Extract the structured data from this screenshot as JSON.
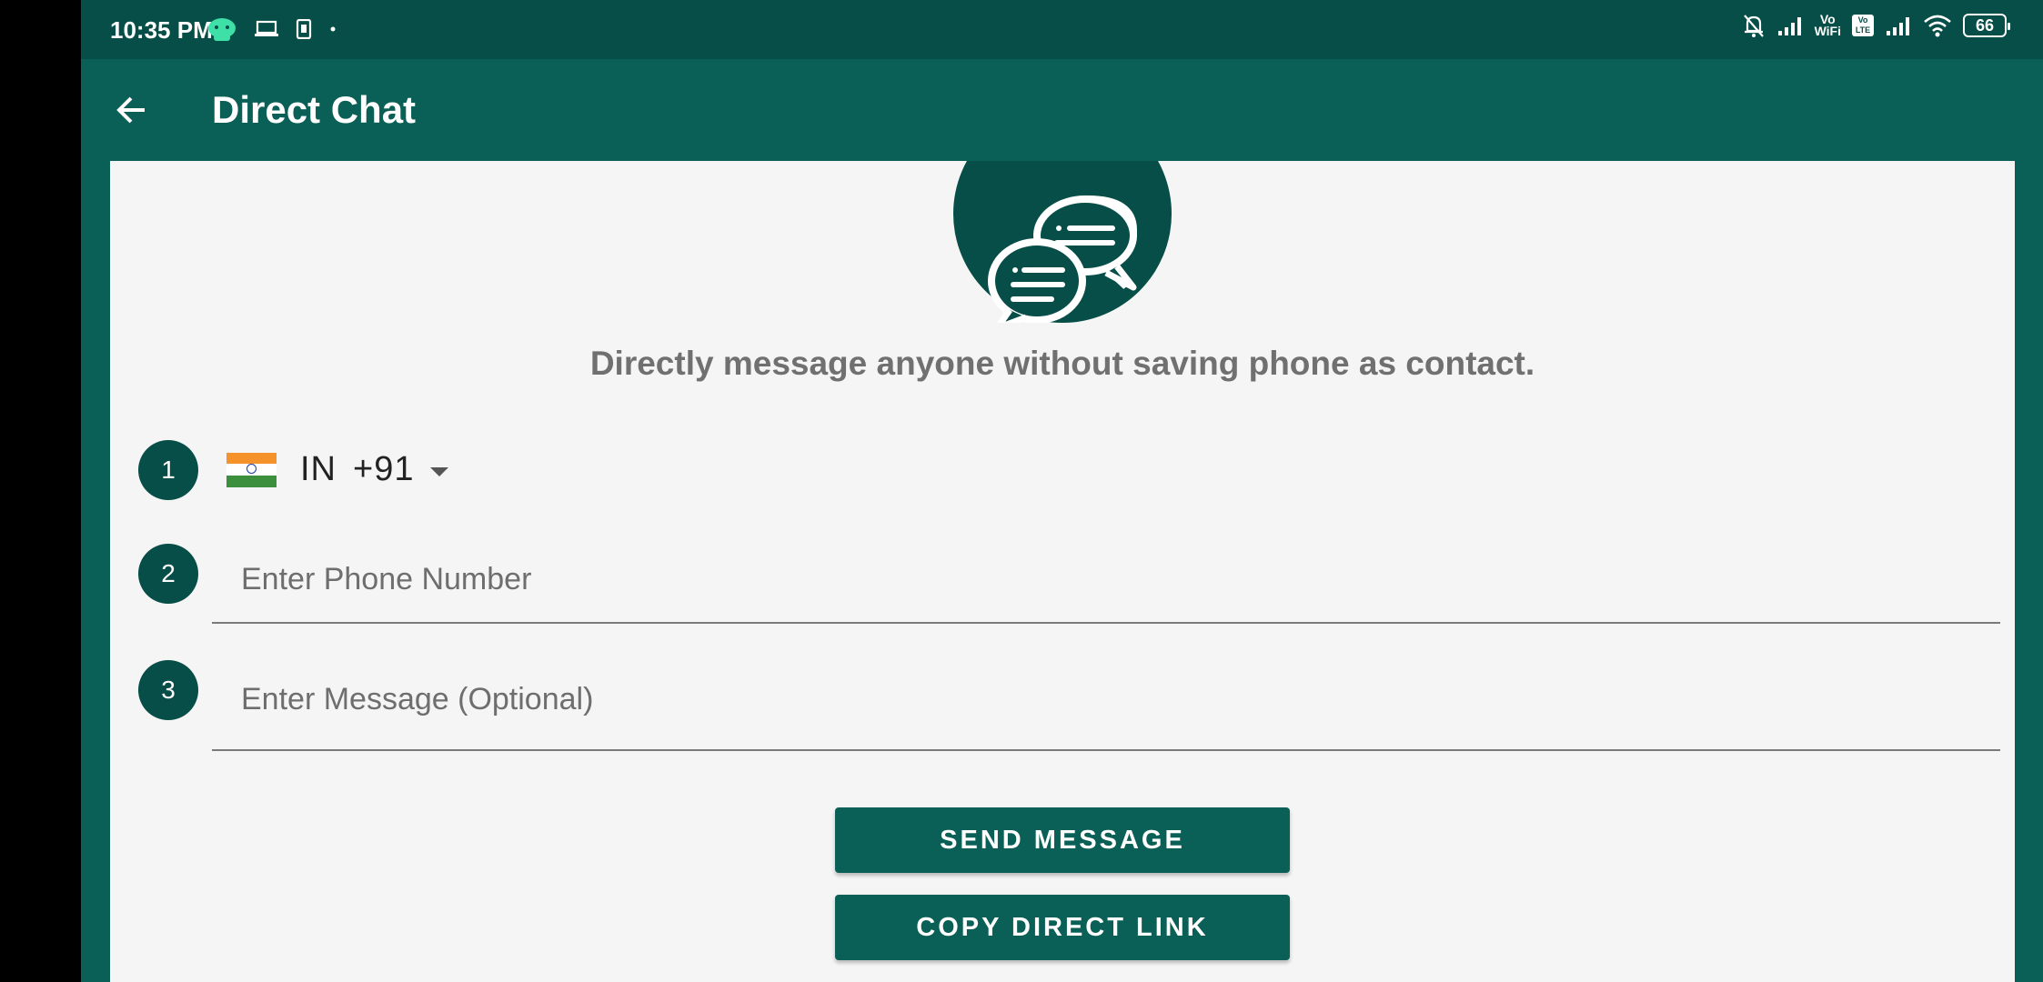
{
  "status_bar": {
    "time": "10:35 PM",
    "left_icons": [
      "chat-bubble-icon",
      "laptop-icon",
      "sim-card-icon",
      "dot-icon"
    ],
    "right_icons": [
      "bell-off-icon",
      "signal-icon",
      "vowifi-icon",
      "volte-icon",
      "signal-icon",
      "wifi-icon",
      "battery-icon"
    ],
    "vowifi_label_top": "Vo",
    "vowifi_label_bottom": "WiFi",
    "volte_label": "Vo LTE",
    "battery": "66"
  },
  "app_bar": {
    "title": "Direct Chat",
    "back_icon": "arrow-left-icon"
  },
  "main": {
    "logo_icon": "chat-bubbles-icon",
    "tagline": "Directly message anyone without saving phone as contact.",
    "steps": [
      "1",
      "2",
      "3"
    ],
    "country": {
      "code": "IN",
      "dial": "+91",
      "flag_icon": "india-flag-icon"
    },
    "phone_placeholder": "Enter Phone Number",
    "message_placeholder": "Enter Message (Optional)",
    "send_button": "SEND MESSAGE",
    "copy_button": "COPY DIRECT LINK"
  },
  "colors": {
    "status_bar": "#064e47",
    "app_bar": "#0a5f56",
    "card_bg": "#f5f5f5",
    "step_circle": "#064e47"
  }
}
